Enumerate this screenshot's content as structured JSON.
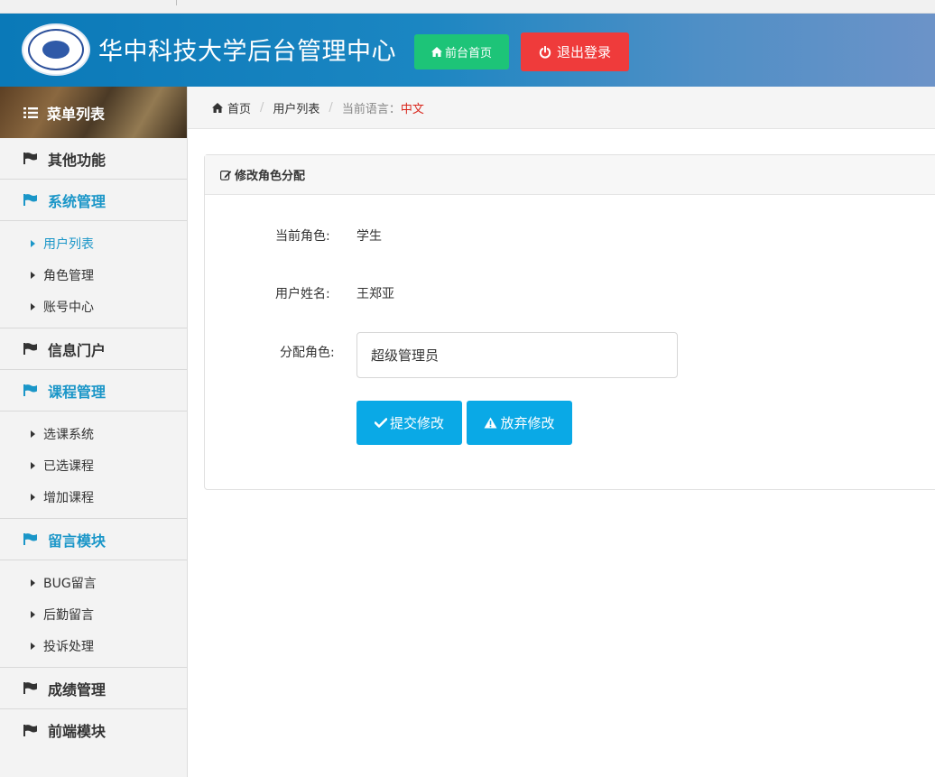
{
  "header": {
    "title": "华中科技大学后台管理中心",
    "home_button": "前台首页",
    "logout_button": "退出登录",
    "colors": {
      "home": "#1dc478",
      "logout": "#ef3b3b"
    }
  },
  "sidebar": {
    "title": "菜单列表",
    "groups": [
      {
        "label": "其他功能",
        "active": false
      },
      {
        "label": "系统管理",
        "active": true,
        "items": [
          "用户列表",
          "角色管理",
          "账号中心"
        ]
      },
      {
        "label": "信息门户",
        "active": false
      },
      {
        "label": "课程管理",
        "active": true,
        "items": [
          "选课系统",
          "已选课程",
          "增加课程"
        ]
      },
      {
        "label": "留言模块",
        "active": true,
        "items": [
          "BUG留言",
          "后勤留言",
          "投诉处理"
        ]
      },
      {
        "label": "成绩管理",
        "active": false
      },
      {
        "label": "前端模块",
        "active": false
      }
    ],
    "active_item": "用户列表"
  },
  "breadcrumb": {
    "home": "首页",
    "page": "用户列表",
    "lang_label": "当前语言：",
    "lang_value": "中文"
  },
  "panel": {
    "title": "修改角色分配",
    "current_role_label": "当前角色:",
    "current_role_value": "学生",
    "username_label": "用户姓名:",
    "username_value": "王郑亚",
    "assign_label": "分配角色:",
    "assign_value": "超级管理员",
    "submit_button": "提交修改",
    "cancel_button": "放弃修改"
  },
  "icons": {
    "home": "home-icon",
    "power": "power-icon",
    "list": "list-icon",
    "flag": "flag-icon",
    "edit": "edit-icon",
    "check": "check-icon",
    "warning": "warning-icon"
  }
}
